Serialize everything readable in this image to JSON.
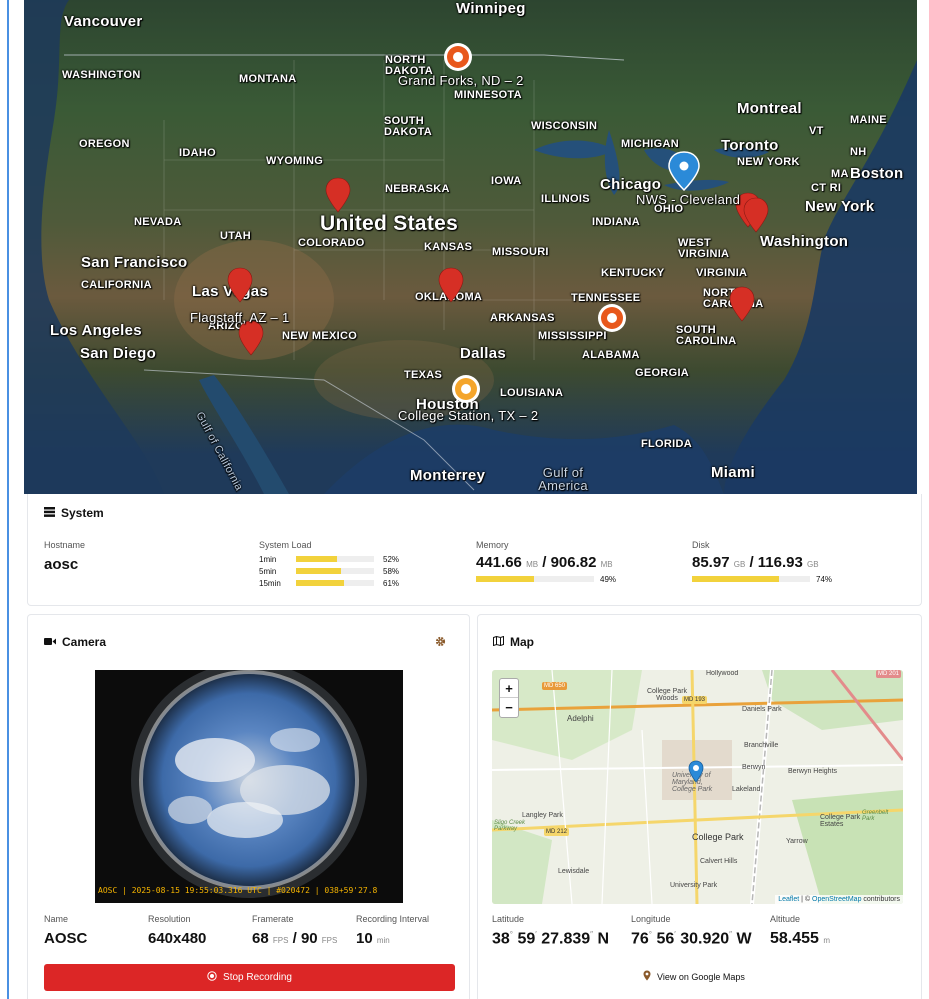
{
  "top_map": {
    "states": [
      "WASHINGTON",
      "MONTANA",
      "NORTH DAKOTA",
      "MINNESOTA",
      "SOUTH DAKOTA",
      "WISCONSIN",
      "MICHIGAN",
      "MAINE",
      "VT",
      "NH",
      "NEW YORK",
      "MA",
      "CT RI",
      "OREGON",
      "IDAHO",
      "WYOMING",
      "NEBRASKA",
      "IOWA",
      "ILLINOIS",
      "OHIO",
      "INDIANA",
      "NEVADA",
      "UTAH",
      "COLORADO",
      "KANSAS",
      "MISSOURI",
      "WEST VIRGINIA",
      "VIRGINIA",
      "KENTUCKY",
      "CALIFORNIA",
      "OKLAHOMA",
      "TENNESSEE",
      "NORTH CAROLINA",
      "ARIZONA",
      "NEW MEXICO",
      "ARKANSAS",
      "MISSISSIPPI",
      "SOUTH CAROLINA",
      "ALABAMA",
      "GEORGIA",
      "TEXAS",
      "LOUISIANA",
      "FLORIDA"
    ],
    "cities": [
      "Vancouver",
      "Winnipeg",
      "Montreal",
      "Toronto",
      "Boston",
      "New York",
      "Chicago",
      "Washington",
      "San Francisco",
      "Las Vegas",
      "Los Angeles",
      "San Diego",
      "Dallas",
      "Houston",
      "Monterrey",
      "Miami"
    ],
    "country": "United States",
    "water": [
      "Gulf of California",
      "Gulf of America"
    ],
    "marker_labels": [
      "Grand Forks, ND – 2",
      "NWS - Cleveland",
      "Flagstaff, AZ – 1",
      "College Station, TX – 2"
    ]
  },
  "system": {
    "title": "System",
    "hostname_label": "Hostname",
    "hostname": "aosc",
    "load_label": "System Load",
    "load": [
      {
        "label": "1min",
        "pct": 52,
        "pct_text": "52%"
      },
      {
        "label": "5min",
        "pct": 58,
        "pct_text": "58%"
      },
      {
        "label": "15min",
        "pct": 61,
        "pct_text": "61%"
      }
    ],
    "memory_label": "Memory",
    "memory_used": "441.66",
    "memory_total": "906.82",
    "memory_unit": "MB",
    "memory_pct": 49,
    "memory_pct_text": "49%",
    "disk_label": "Disk",
    "disk_used": "85.97",
    "disk_total": "116.93",
    "disk_unit": "GB",
    "disk_pct": 74,
    "disk_pct_text": "74%"
  },
  "camera": {
    "title": "Camera",
    "overlay": "AOSC | 2025-08-15 19:55:03.316 UTC | #020472 | 038+59'27.8",
    "name_label": "Name",
    "name": "AOSC",
    "resolution_label": "Resolution",
    "resolution": "640x480",
    "framerate_label": "Framerate",
    "framerate_actual": "68",
    "framerate_target": "90",
    "fps_unit": "FPS",
    "interval_label": "Recording Interval",
    "interval": "10",
    "interval_unit": "min",
    "stop_label": "Stop Recording"
  },
  "map": {
    "title": "Map",
    "zoom_in": "+",
    "zoom_out": "−",
    "attribution_leaflet": "Leaflet",
    "attribution_sep": " | © ",
    "attribution_osm": "OpenStreetMap",
    "attribution_tail": " contributors",
    "places": [
      "Hollywood",
      "College Park Woods",
      "Daniels Park",
      "Adelphi",
      "Branchville",
      "Berwyn",
      "Berwyn Heights",
      "University of Maryland, College Park",
      "Lakeland",
      "Langley Park",
      "College Park",
      "College Park Estates",
      "Yarrow",
      "Calvert Hills",
      "Lewisdale",
      "University Park",
      "Sligo Creek Parkway",
      "Greenbelt Park"
    ],
    "roads": [
      "MD 650",
      "MD 193",
      "MD 212",
      "MD 201"
    ],
    "latitude_label": "Latitude",
    "lat_deg": "38",
    "lat_min": "59",
    "lat_sec": "27.839",
    "lat_dir": "N",
    "longitude_label": "Longitude",
    "lon_deg": "76",
    "lon_min": "56",
    "lon_sec": "30.920",
    "lon_dir": "W",
    "altitude_label": "Altitude",
    "altitude": "58.455",
    "altitude_unit": "m",
    "google_label": "View on Google Maps"
  }
}
